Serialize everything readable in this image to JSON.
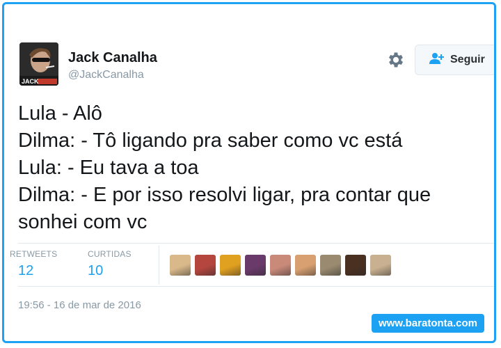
{
  "user": {
    "display_name": "Jack Canalha",
    "handle": "@JackCanalha",
    "avatar_badge": "JACK"
  },
  "follow_button": {
    "label": "Seguir",
    "icon": "add-user-icon"
  },
  "settings_icon": "gear-icon",
  "tweet": {
    "lines": [
      "Lula - Alô",
      "Dilma: - Tô ligando pra saber como vc está",
      "Lula: - Eu tava a toa",
      "Dilma: - E por isso resolvi ligar, pra contar que",
      "sonhei com vc"
    ]
  },
  "stats": {
    "retweets_label": "RETWEETS",
    "retweets_value": "12",
    "likes_label": "CURTIDAS",
    "likes_value": "10"
  },
  "liked_by_avatars": [
    {
      "color": "#d9b98a"
    },
    {
      "color": "#b5463e"
    },
    {
      "color": "#e0a020"
    },
    {
      "color": "#6a3a6a"
    },
    {
      "color": "#c98a7a"
    },
    {
      "color": "#d8a070"
    },
    {
      "color": "#9a8a70"
    },
    {
      "color": "#4a3020"
    },
    {
      "color": "#c8b090"
    }
  ],
  "timestamp": "19:56 - 16 de mar de 2016",
  "watermark": "www.baratonta.com",
  "colors": {
    "accent": "#1da1f2",
    "text": "#14171a",
    "muted": "#8899a6"
  }
}
